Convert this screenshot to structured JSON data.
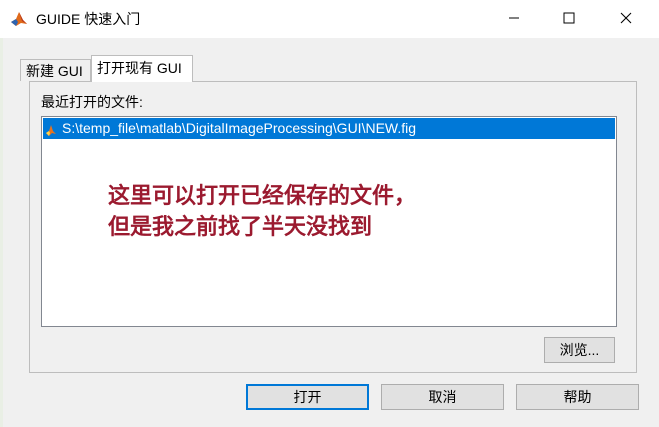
{
  "window": {
    "title": "GUIDE 快速入门",
    "app_icon": "matlab-logo-icon",
    "controls": [
      "minimize-icon",
      "maximize-icon",
      "close-icon"
    ]
  },
  "tabs": [
    {
      "label": "新建 GUI",
      "selected": false
    },
    {
      "label": "打开现有 GUI",
      "selected": true
    }
  ],
  "recent": {
    "label": "最近打开的文件:",
    "items": [
      {
        "icon": "fig-file-icon",
        "path": "S:\\temp_file\\matlab\\DigitalImageProcessing\\GUI\\NEW.fig",
        "selected": true
      }
    ]
  },
  "annotation": {
    "line1": "这里可以打开已经保存的文件，",
    "line2": "但是我之前找了半天没找到",
    "color": "#9b1a2f"
  },
  "buttons": {
    "browse": "浏览...",
    "open": "打开",
    "cancel": "取消",
    "help": "帮助"
  },
  "colors": {
    "selection": "#0078d7",
    "default_button_border": "#0078d7"
  }
}
